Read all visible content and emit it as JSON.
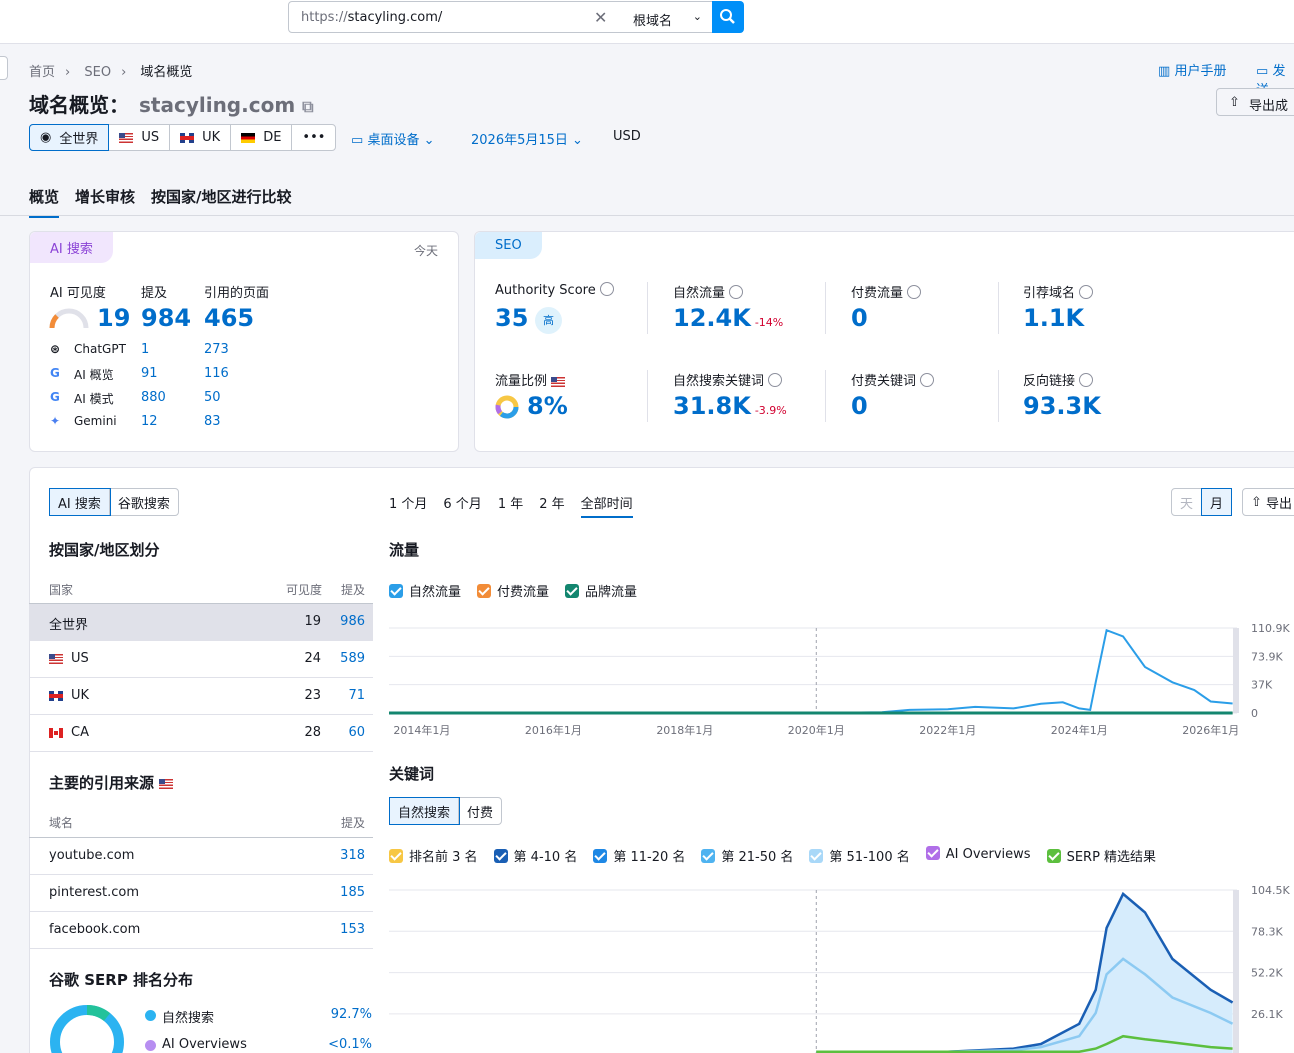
{
  "search": {
    "prefix": "https://",
    "domain": "stacyling.com/",
    "scope": "根域名"
  },
  "breadcrumb": [
    "首页",
    "SEO",
    "域名概览"
  ],
  "header": {
    "title": "域名概览：",
    "domain": "stacyling.com",
    "manual": "用户手册",
    "feedback": "发送",
    "export": "导出成"
  },
  "regions": [
    {
      "label": "全世界"
    },
    {
      "label": "US"
    },
    {
      "label": "UK"
    },
    {
      "label": "DE"
    }
  ],
  "more": "•••",
  "device": "桌面设备",
  "date": "2026年5月15日",
  "currency": "USD",
  "tabs": [
    "概览",
    "增长审核",
    "按国家/地区进行比较"
  ],
  "ai_card": {
    "pill": "AI 搜索",
    "today": "今天",
    "visibility_label": "AI 可见度",
    "mentions_label": "提及",
    "cited_label": "引用的页面",
    "visibility": "19",
    "mentions": "984",
    "cited": "465",
    "sources": [
      {
        "name": "ChatGPT",
        "mentions": "1",
        "pages": "273",
        "icon": "chatgpt-icon"
      },
      {
        "name": "AI 概览",
        "mentions": "91",
        "pages": "116",
        "icon": "google-icon"
      },
      {
        "name": "AI 模式",
        "mentions": "880",
        "pages": "50",
        "icon": "google-icon"
      },
      {
        "name": "Gemini",
        "mentions": "12",
        "pages": "83",
        "icon": "gemini-icon"
      }
    ]
  },
  "seo_card": {
    "pill": "SEO",
    "authority_label": "Authority Score",
    "authority": "35",
    "authority_badge": "高",
    "organic_label": "自然流量",
    "organic": "12.4K",
    "organic_change": "-14%",
    "paid_label": "付费流量",
    "paid": "0",
    "ref_label": "引荐域名",
    "ref": "1.1K",
    "share_label": "流量比例",
    "share": "8%",
    "kw_label": "自然搜索关键词",
    "kw": "31.8K",
    "kw_change": "-3.9%",
    "paid_kw_label": "付费关键词",
    "paid_kw": "0",
    "backlinks_label": "反向链接",
    "backlinks": "93.3K"
  },
  "left_panel": {
    "toggle": [
      "AI 搜索",
      "谷歌搜索"
    ],
    "country_title": "按国家/地区划分",
    "country_headers": [
      "国家",
      "可见度",
      "提及"
    ],
    "countries": [
      {
        "name": "全世界",
        "vis": "19",
        "mentions": "986"
      },
      {
        "name": "US",
        "vis": "24",
        "mentions": "589"
      },
      {
        "name": "UK",
        "vis": "23",
        "mentions": "71"
      },
      {
        "name": "CA",
        "vis": "28",
        "mentions": "60"
      }
    ],
    "sources_title": "主要的引用来源",
    "sources_headers": [
      "域名",
      "提及"
    ],
    "sources": [
      {
        "domain": "youtube.com",
        "count": "318"
      },
      {
        "domain": "pinterest.com",
        "count": "185"
      },
      {
        "domain": "facebook.com",
        "count": "153"
      }
    ],
    "serp_title": "谷歌 SERP 排名分布",
    "serp": [
      {
        "label": "自然搜索",
        "value": "92.7%",
        "color": "#2bb3f1"
      },
      {
        "label": "AI Overviews",
        "value": "<0.1%",
        "color": "#b78ef1"
      }
    ]
  },
  "ranges": [
    "1 个月",
    "6 个月",
    "1 年",
    "2 年",
    "全部时间"
  ],
  "granularity": [
    "天",
    "月"
  ],
  "export2": "导出",
  "traffic": {
    "title": "流量",
    "legend": [
      {
        "label": "自然流量",
        "color": "#2b9ee8"
      },
      {
        "label": "付费流量",
        "color": "#f28c38"
      },
      {
        "label": "品牌流量",
        "color": "#13866f"
      }
    ],
    "y_ticks": [
      "110.9K",
      "73.9K",
      "37K",
      "0"
    ],
    "x_ticks": [
      "2014年1月",
      "2016年1月",
      "2018年1月",
      "2020年1月",
      "2022年1月",
      "2024年1月",
      "2026年1月"
    ]
  },
  "keywords": {
    "title": "关键词",
    "toggle": [
      "自然搜索",
      "付费"
    ],
    "legend": [
      {
        "label": "排名前 3 名",
        "color": "#f7c744"
      },
      {
        "label": "第 4-10 名",
        "color": "#1a5fb4"
      },
      {
        "label": "第 11-20 名",
        "color": "#1e88e5"
      },
      {
        "label": "第 21-50 名",
        "color": "#4fb3f0"
      },
      {
        "label": "第 51-100 名",
        "color": "#a9d8f8"
      },
      {
        "label": "AI Overviews",
        "color": "#b06fe8"
      },
      {
        "label": "SERP 精选结果",
        "color": "#5cbf3e"
      }
    ],
    "y_ticks": [
      "104.5K",
      "78.3K",
      "52.2K",
      "26.1K"
    ]
  },
  "chart_data": [
    {
      "type": "line",
      "title": "流量",
      "x": [
        "2013-06",
        "2014-01",
        "2016-01",
        "2018-01",
        "2020-01",
        "2021-01",
        "2021-06",
        "2022-01",
        "2022-06",
        "2023-01",
        "2023-06",
        "2023-10",
        "2024-01",
        "2024-03",
        "2024-04",
        "2024-06",
        "2024-09",
        "2025-01",
        "2025-06",
        "2025-10",
        "2026-01",
        "2026-05"
      ],
      "series": [
        {
          "name": "自然流量",
          "values": [
            0,
            0,
            0,
            0,
            0,
            1000,
            4000,
            5000,
            8000,
            6000,
            12000,
            14000,
            6000,
            4000,
            40000,
            108000,
            100000,
            60000,
            40000,
            30000,
            15000,
            12400
          ]
        },
        {
          "name": "付费流量",
          "values": [
            0,
            0,
            0,
            0,
            0,
            0,
            0,
            0,
            0,
            0,
            0,
            0,
            0,
            0,
            0,
            0,
            0,
            0,
            0,
            0,
            0,
            0
          ]
        },
        {
          "name": "品牌流量",
          "values": [
            0,
            0,
            0,
            0,
            0,
            0,
            0,
            0,
            0,
            0,
            0,
            0,
            0,
            0,
            0,
            0,
            0,
            0,
            0,
            0,
            0,
            0
          ]
        }
      ],
      "ylim": [
        0,
        110900
      ]
    },
    {
      "type": "area",
      "title": "关键词",
      "x": [
        "2020-01",
        "2021-01",
        "2022-01",
        "2023-01",
        "2023-06",
        "2024-01",
        "2024-04",
        "2024-06",
        "2024-09",
        "2025-01",
        "2025-06",
        "2026-01",
        "2026-05"
      ],
      "series": [
        {
          "name": "第 51-100 名",
          "values": [
            0,
            0,
            0,
            2000,
            5000,
            18000,
            40000,
            80000,
            102000,
            90000,
            60000,
            40000,
            31800
          ]
        },
        {
          "name": "第 21-50 名",
          "values": [
            0,
            0,
            0,
            1000,
            3000,
            10000,
            25000,
            50000,
            60000,
            50000,
            35000,
            25000,
            18000
          ]
        },
        {
          "name": "SERP 精选结果",
          "values": [
            0,
            0,
            0,
            0,
            0,
            0,
            2000,
            5000,
            10000,
            8000,
            6000,
            3000,
            2000
          ]
        }
      ],
      "ylim": [
        0,
        104500
      ]
    }
  ]
}
